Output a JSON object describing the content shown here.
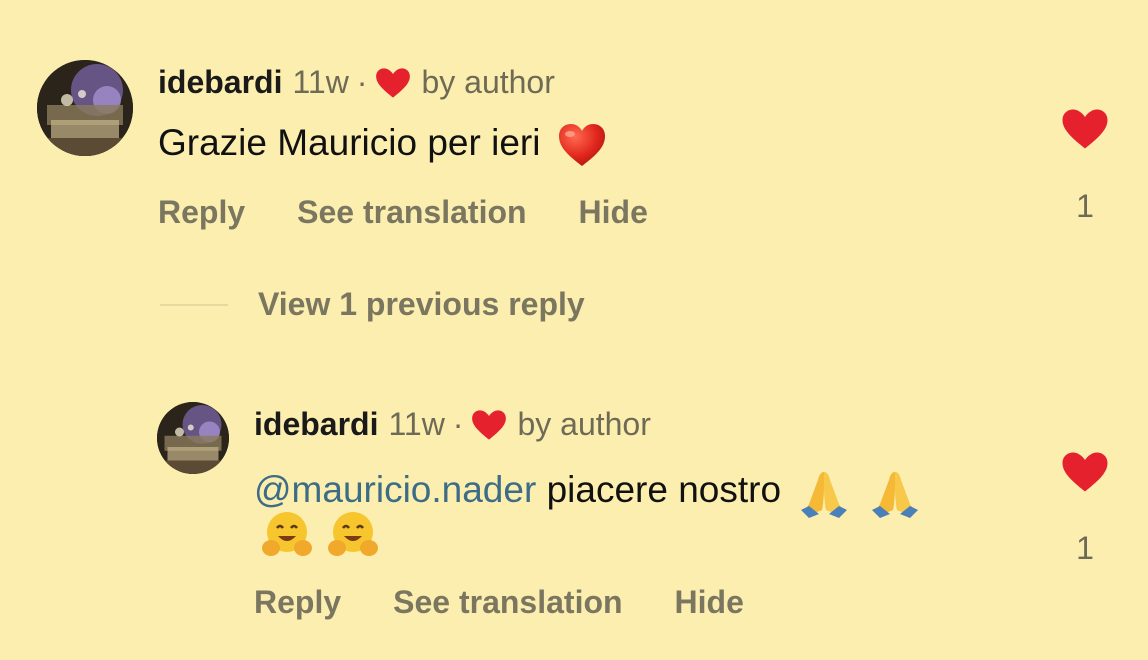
{
  "colors": {
    "background": "#fbeeae",
    "heart": "#e5212e",
    "mention": "#3d6d86",
    "muted": "#7a7660"
  },
  "comment": {
    "username": "idebardi",
    "time": "11w",
    "separator": "·",
    "liked_by": "by author",
    "text": "Grazie Mauricio per ieri",
    "emoji": "red-heart-emoji",
    "actions": [
      "Reply",
      "See translation",
      "Hide"
    ],
    "like_icon": "heart-icon",
    "like_count": "1"
  },
  "view_previous": "View 1 previous reply",
  "reply": {
    "username": "idebardi",
    "time": "11w",
    "separator": "·",
    "liked_by": "by author",
    "mention": "@mauricio.nader",
    "text": " piacere nostro",
    "emojis": [
      "folded-hands-emoji",
      "folded-hands-emoji",
      "hugging-face-emoji",
      "hugging-face-emoji"
    ],
    "actions": [
      "Reply",
      "See translation",
      "Hide"
    ],
    "like_icon": "heart-icon",
    "like_count": "1"
  }
}
